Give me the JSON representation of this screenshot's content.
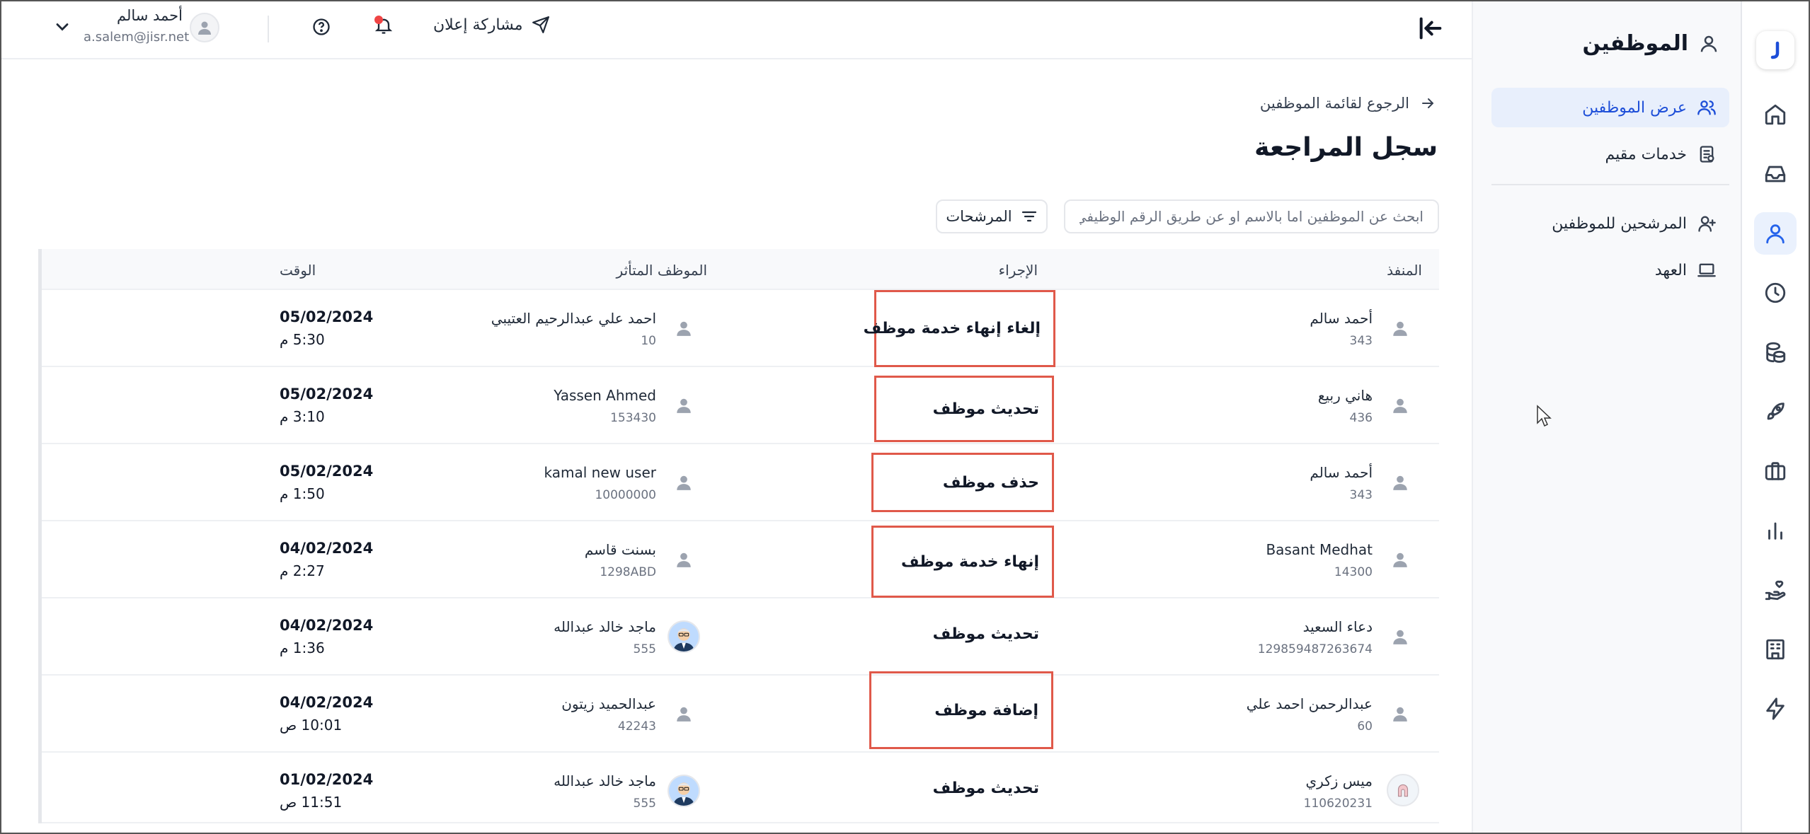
{
  "header": {
    "share_label": "مشاركة إعلان",
    "user_name": "أحمد سالم",
    "user_email": "a.salem@jisr.net"
  },
  "sidebar": {
    "section_title": "الموظفين",
    "items": [
      {
        "label": "عرض الموظفين",
        "icon": "users-icon",
        "active": true
      },
      {
        "label": "خدمات مقيم",
        "icon": "document-icon",
        "active": false
      },
      {
        "label": "المرشحين للموظفين",
        "icon": "user-plus-icon",
        "active": false
      },
      {
        "label": "العهد",
        "icon": "laptop-icon",
        "active": false
      }
    ]
  },
  "rail": {
    "icons": [
      "home-icon",
      "inbox-icon",
      "user-icon",
      "clock-icon",
      "coins-icon",
      "rocket-icon",
      "briefcase-icon",
      "bar-chart-icon",
      "hand-heart-icon",
      "building-icon",
      "lightning-icon"
    ],
    "active": "user-icon",
    "accent": "#2563eb"
  },
  "main": {
    "back_label": "الرجوع لقائمة الموظفين",
    "title": "سجل المراجعة",
    "search_placeholder": "ابحث عن الموظفين اما بالاسم او عن طريق الرقم الوظيفي",
    "filters_label": "المرشحات"
  },
  "table": {
    "headers": {
      "executor": "المنفذ",
      "action": "الإجراء",
      "affected": "الموظف المتأثر",
      "time": "الوقت"
    },
    "rows": [
      {
        "executor_name": "أحمد سالم",
        "executor_id": "343",
        "action": "إلغاء إنهاء خدمة موظف",
        "affected_name": "احمد علي عبدالرحيم العتيبي",
        "affected_id": "10",
        "date": "05/02/2024",
        "time": "5:30 م"
      },
      {
        "executor_name": "هاني ربيع",
        "executor_id": "436",
        "action": "تحديث موظف",
        "affected_name": "Yassen Ahmed",
        "affected_id": "153430",
        "date": "05/02/2024",
        "time": "3:10 م"
      },
      {
        "executor_name": "أحمد سالم",
        "executor_id": "343",
        "action": "حذف موظف",
        "affected_name": "kamal new user",
        "affected_id": "10000000",
        "date": "05/02/2024",
        "time": "1:50 م"
      },
      {
        "executor_name": "Basant Medhat",
        "executor_id": "14300",
        "action": "إنهاء خدمة موظف",
        "affected_name": "بسنت قاسم",
        "affected_id": "1298ABD",
        "date": "04/02/2024",
        "time": "2:27 م"
      },
      {
        "executor_name": "دعاء السعيد",
        "executor_id": "129859487263674",
        "action": "تحديث موظف",
        "affected_name": "ماجد خالد عبدالله",
        "affected_id": "555",
        "date": "04/02/2024",
        "time": "1:36 م"
      },
      {
        "executor_name": "عبدالرحمن احمد علي",
        "executor_id": "60",
        "action": "إضافة موظف",
        "affected_name": "عبدالحميد زيتون",
        "affected_id": "42243",
        "date": "04/02/2024",
        "time": "10:01 ص"
      },
      {
        "executor_name": "ميس زكري",
        "executor_id": "110620231",
        "action": "تحديث موظف",
        "affected_name": "ماجد خالد عبدالله",
        "affected_id": "555",
        "date": "01/02/2024",
        "time": "11:51 ص"
      }
    ]
  }
}
